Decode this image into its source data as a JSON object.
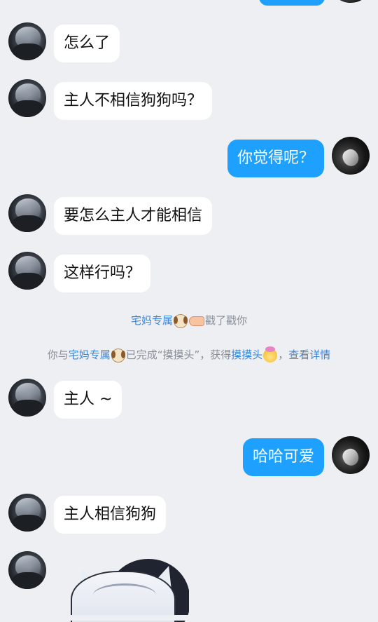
{
  "messages": [
    {
      "side": "other",
      "text": "怎么了"
    },
    {
      "side": "other",
      "text": "主人不相信狗狗吗？"
    },
    {
      "side": "me",
      "text": "你觉得呢？"
    },
    {
      "side": "other",
      "text": "要怎么主人才能相信"
    },
    {
      "side": "other",
      "text": "这样行吗？"
    },
    {
      "side": "other",
      "text": "主人 ~"
    },
    {
      "side": "me",
      "text": "哈哈可爱"
    },
    {
      "side": "other",
      "text": "主人相信狗狗"
    }
  ],
  "system": {
    "poke": {
      "name": "宅妈专属",
      "name_icon": "dog-face-emoji",
      "action_icon": "pointing-hand-emoji",
      "action": "戳了戳你"
    },
    "achievement": {
      "prefix": "你与",
      "name": "宅妈专属",
      "name_icon": "dog-face-emoji",
      "middle": "已完成“摸摸头”，获得",
      "reward": "摸摸头",
      "reward_icon": "head-pat-emoji",
      "separator": "，",
      "detail_link": "查看详情"
    }
  },
  "sticker": {
    "icon": "cat-ear-hoodie-sticker"
  },
  "colors": {
    "background": "#EEEFF3",
    "my_bubble": "#1EA1FE",
    "other_bubble": "#FFFFFF",
    "link": "#3B86D8",
    "system_text": "#888E97"
  }
}
